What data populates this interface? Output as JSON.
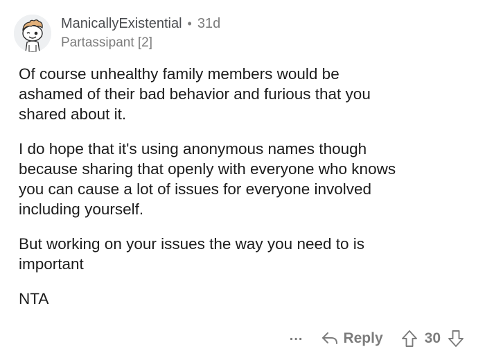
{
  "comment": {
    "author": "ManicallyExistential",
    "separator": "•",
    "age": "31d",
    "flair": "Partassipant [2]",
    "paragraphs": [
      "Of course unhealthy family members would be\nashamed of their bad behavior and furious that you\nshared about it.",
      "I do hope that it's using anonymous names though\nbecause sharing that openly with everyone who knows\nyou can cause a lot of issues for everyone involved\nincluding yourself.",
      "But working on your issues the way you need to is\nimportant",
      "NTA"
    ]
  },
  "actions": {
    "more_label": "...",
    "reply_label": "Reply",
    "score": "30"
  },
  "icons": {
    "avatar": "snoo-avatar",
    "more": "more-options-icon",
    "reply": "reply-arrow-icon",
    "upvote": "upvote-arrow-icon",
    "downvote": "downvote-arrow-icon"
  },
  "colors": {
    "meta_text": "#7c7c7c",
    "body_text": "#1c1c1c",
    "avatar_bg": "#eef0f2"
  }
}
